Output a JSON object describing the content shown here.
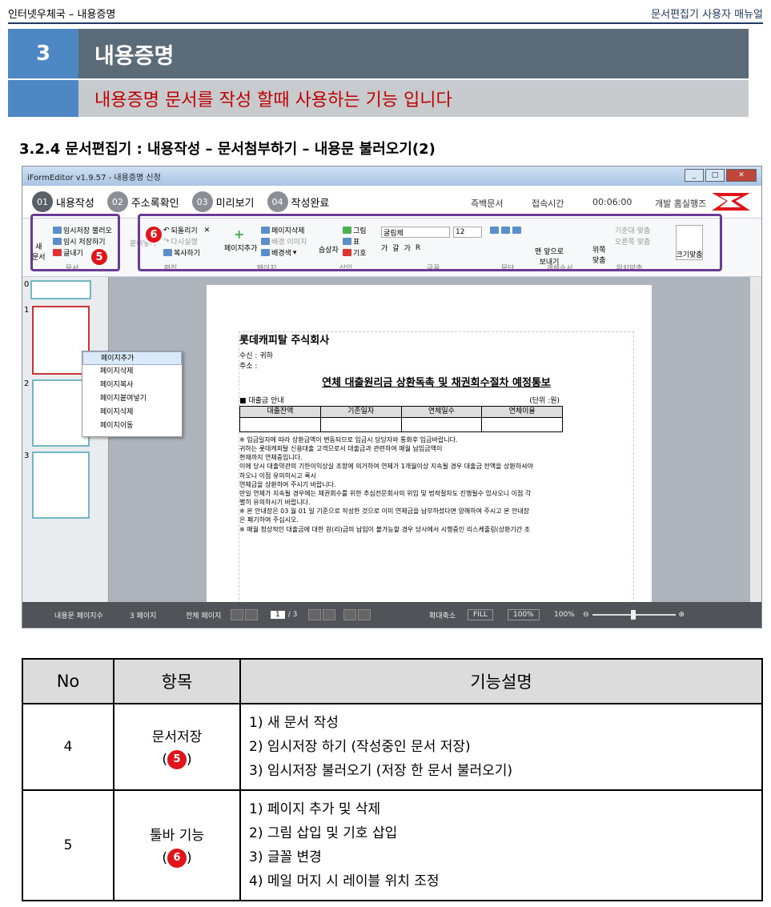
{
  "header": {
    "left": "인터넷우체국 – 내용증명",
    "right": "문서편집기 사용자 매뉴얼"
  },
  "chapter": {
    "number": "3",
    "title": "내용증명",
    "subtitle": "내용증명 문서를 작성 할때 사용하는 기능 입니다"
  },
  "section_title": "3.2.4 문서편집기 : 내용작성 – 문서첨부하기 –  내용문 불러오기(2)",
  "app": {
    "window_title": "iFormEditor v1.9.57 - 내용증명 신청",
    "steps": [
      {
        "num": "01",
        "label": "내용작성"
      },
      {
        "num": "02",
        "label": "주소록확인"
      },
      {
        "num": "03",
        "label": "미리보기"
      },
      {
        "num": "04",
        "label": "작성완료"
      }
    ],
    "status": {
      "doc": "즉백문서",
      "access": "접속시간",
      "time": "00:06:00",
      "user": "개발 홈실행즈"
    },
    "ribbon": {
      "doc_group": {
        "label": "문서",
        "new": "새\n문서",
        "items": [
          "임시저장 불러오",
          "임시 저장하기",
          "글내기"
        ]
      },
      "edit_group": {
        "label": "편집",
        "items": [
          "되돌리기",
          "다시실행",
          "복사하기"
        ],
        "paste": "붙여넣기"
      },
      "page_group": {
        "label": "페이지",
        "add": "페이지추가",
        "items": [
          "페이지삭제",
          "배경 이미지",
          "배경색"
        ]
      },
      "insert_group": {
        "label": "삽입",
        "shape": "슴상자",
        "items": [
          "그림",
          "표",
          "기호"
        ]
      },
      "font_group": {
        "label": "글꼴",
        "font": "굴림체",
        "size": "12",
        "styles": [
          "가",
          "갈",
          "가",
          "R"
        ]
      },
      "para_group": {
        "label": "문단"
      },
      "object_group": {
        "label": "개체순서",
        "front": "맨 앞으로\n보내기"
      },
      "pos_group": {
        "label": "위치맞춤",
        "align": "위쪽\n맞춤",
        "items": [
          "기준대 맞춤",
          "오른쪽 맞춤"
        ]
      },
      "fit": "크기맞춤"
    },
    "badge5": "5",
    "badge6": "6",
    "thumbs": [
      "0",
      "1",
      "2",
      "3"
    ],
    "context_menu": [
      "페이지추가",
      "페이지삭제",
      "페이지복사",
      "페이지붙여넣기",
      "페이지삭제",
      "페이지이동"
    ],
    "doc": {
      "company": "롯데캐피탈  주식회사",
      "recipient": "수신 :                귀하",
      "address": "주소 :",
      "title": "연체  대출원리금  상환독촉  및  채권회수절차  예정통보",
      "loan_info": "■ 대출금 안내",
      "unit": "(단위 :원)",
      "table_headers": [
        "대출잔액",
        "기존일자",
        "연체일수",
        "연체이율"
      ],
      "lines": [
        "※ 입금일자에 따라 상환금액이 변동되므로 입금시 당당자와 통화후 입금바랍니다.",
        "귀하는 롯데캐피탈 신용대출 고객으로서 대출금과 관련하여 매월 납입금액이",
        "현재까지 연체중입니다.",
        "이에 당시 대출약관의 기한이익상실 조항에 의거하여 연체가 1개월이상 지속될 경우 대출금 전액을 상환하셔야",
        "하오니 이점 유의하시고 록시",
        "연체금을 상환하여 주시기 바랍니다.",
        "만일 연체가 지속될 경우에는 채권회수를 위한 추심전문회사의 위임 및 법적절차도 진행될수 있사오니 이점 각",
        "별히 유의하시기 바랍니다.",
        "※ 본 안내장은 03 월 01 일 기준으로 작성한 것으로 이미 연체금을 납부하셨다면 양해하여 주시고 본 안내장",
        "   은 폐기하여 주십시오.",
        "※ 매월 청상적인 대출금에 대한 원(리)금의 납입이 불가능할 경우 당사에서 시행중인 리스케줄링(상환기간 조"
      ]
    },
    "statusbar": {
      "page_count_label": "내용문 페이지수",
      "page_count": "3 페이지",
      "total_label": "전체 페이지",
      "current": "1",
      "total": "/ 3",
      "zoom_label": "확대축소",
      "fill": "FILL",
      "pct_btn": "100%",
      "zoom": "100%"
    }
  },
  "table": {
    "headers": [
      "No",
      "항목",
      "기능설명"
    ],
    "rows": [
      {
        "no": "4",
        "item": "문서저장",
        "badge": "5",
        "desc": [
          "1) 새 문서 작성",
          "2) 임시저장 하기 (작성중인 문서 저장)",
          "3) 임시저장 불러오기 (저장 한 문서 불러오기)"
        ]
      },
      {
        "no": "5",
        "item": "툴바 기능",
        "badge": "6",
        "desc": [
          "1) 페이지 추가 및 삭제",
          "2) 그림 삽입 및 기호 삽입",
          "3) 글꼴 변경",
          "4) 메일 머지 시 레이블 위치 조정"
        ]
      }
    ]
  }
}
